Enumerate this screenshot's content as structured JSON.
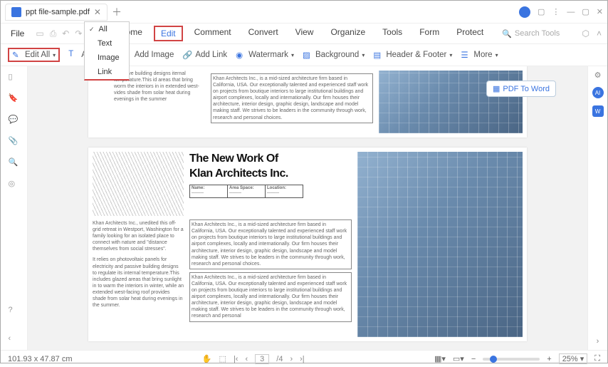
{
  "titlebar": {
    "filename": "ppt file-sample.pdf"
  },
  "menubar": {
    "file": "File",
    "items": [
      "Home",
      "Edit",
      "Comment",
      "Convert",
      "View",
      "Organize",
      "Tools",
      "Form",
      "Protect"
    ],
    "active": "Edit",
    "search_placeholder": "Search Tools"
  },
  "ribbon": {
    "edit_all": "Edit All",
    "dropdown": [
      "All",
      "Text",
      "Image",
      "Link"
    ],
    "items": [
      "Add Text",
      "Add Image",
      "Add Link",
      "Watermark",
      "Background",
      "Header & Footer",
      "More"
    ]
  },
  "sidebar": {
    "pdf_to_word": "PDF To Word"
  },
  "doc": {
    "p1_text": "I passive building designs iternal temperature.This id areas that bring worm the interiors in in extended west- vides shade from solar heat during evenings in the summer",
    "p1_box": "Khan Architects Inc., is a mid-sized architecture firm based in California, USA. Our exceptionally talented and experienced staff work on projects from boutique interiors to large institutional buildings and airport complexes, locally and internationally. Our firm houses their architecture, interior design, graphic design, landscape and model making staff. We strives to be leaders in the community through work, research and personal choices.",
    "h1": "The New Work Of",
    "h2": "Klan Architects Inc.",
    "tbl": {
      "a": "Name:",
      "b": "Area Space:",
      "c": "Location:"
    },
    "p2_left1": "Khan Architects Inc., unedited this off-grid retreat in Westport, Washington for a family looking for an isolated place to connect with nature and \"distance themselves from social stresses\".",
    "p2_left2": "It relies on photovoltaic panels for electricity and passive building designs to regulate its internal temperature.This includes glazed areas that bring sunlight in to warm the interiors in winter, while an extended west-facing roof provides shade from solar heat during evenings in the summer.",
    "p2_box1": "Khan Architects Inc., is a mid-sized architecture firm based in California, USA. Our exceptionally talented and experienced staff work on projects from boutique interiors to large institutional buildings and airport complexes, locally and internationally. Our firm houses their architecture, interior design, graphic design, landscape and model making staff. We strives to be leaders in the community through work, research and personal choices.",
    "p2_box2": "Khan Architects Inc., is a mid-sized architecture firm based in California, USA. Our exceptionally talented and experienced staff work on projects from boutique interiors to large institutional buildings and airport complexes, locally and internationally. Our firm houses their architecture, interior design, graphic design, landscape and model making staff. We strives to be leaders in the community through work, research and personal"
  },
  "status": {
    "dims": "101.93 x 47.87 cm",
    "page_curr": "3",
    "page_total": "/4",
    "zoom": "25%"
  }
}
